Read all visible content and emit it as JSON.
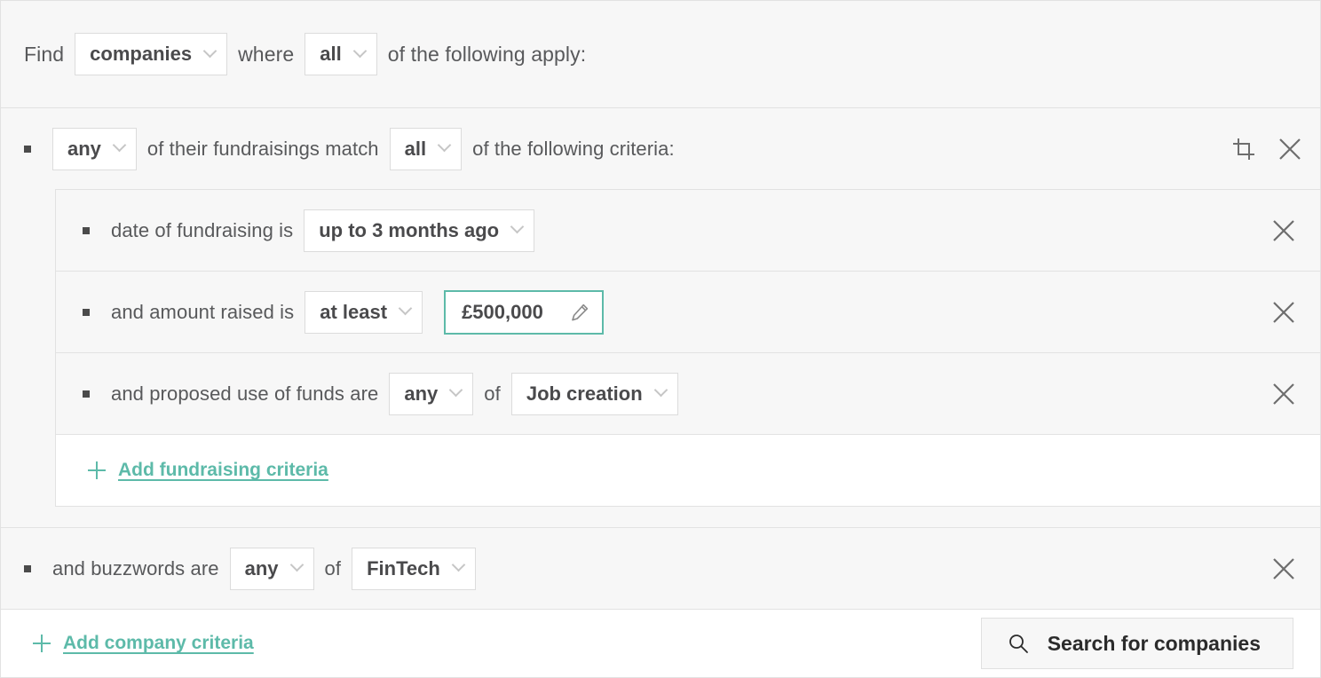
{
  "header": {
    "find_label": "Find",
    "entity_select": "companies",
    "where_label": "where",
    "match_select": "all",
    "suffix_label": "of the following apply:"
  },
  "fundraising_group": {
    "quantifier_select": "any",
    "middle_label": "of their fundraisings match",
    "match_select": "all",
    "suffix_label": "of the following criteria:",
    "actions": {
      "crop_icon": "crop-icon",
      "remove_icon": "close-icon"
    },
    "criteria": [
      {
        "label": "date of fundraising is",
        "selects": [
          "up to 3 months ago"
        ],
        "remove_icon": "close-icon"
      },
      {
        "label": "and amount raised is",
        "selects": [
          "at least"
        ],
        "value_field": "£500,000",
        "edit_icon": "pencil-icon",
        "remove_icon": "close-icon"
      },
      {
        "label": "and proposed use of funds are",
        "selects": [
          "any"
        ],
        "joiner": "of",
        "selects2": [
          "Job creation"
        ],
        "remove_icon": "close-icon"
      }
    ],
    "add_link": "Add fundraising criteria"
  },
  "buzzwords": {
    "label": "and buzzwords are",
    "quantifier_select": "any",
    "joiner": "of",
    "value_select": "FinTech",
    "remove_icon": "close-icon"
  },
  "footer": {
    "add_link": "Add company criteria",
    "search_button": "Search for companies",
    "search_icon": "search-icon"
  },
  "colors": {
    "accent": "#5dbaa9",
    "text": "#58595b",
    "panel_bg": "#f7f7f7",
    "border": "#e2e2e2"
  }
}
